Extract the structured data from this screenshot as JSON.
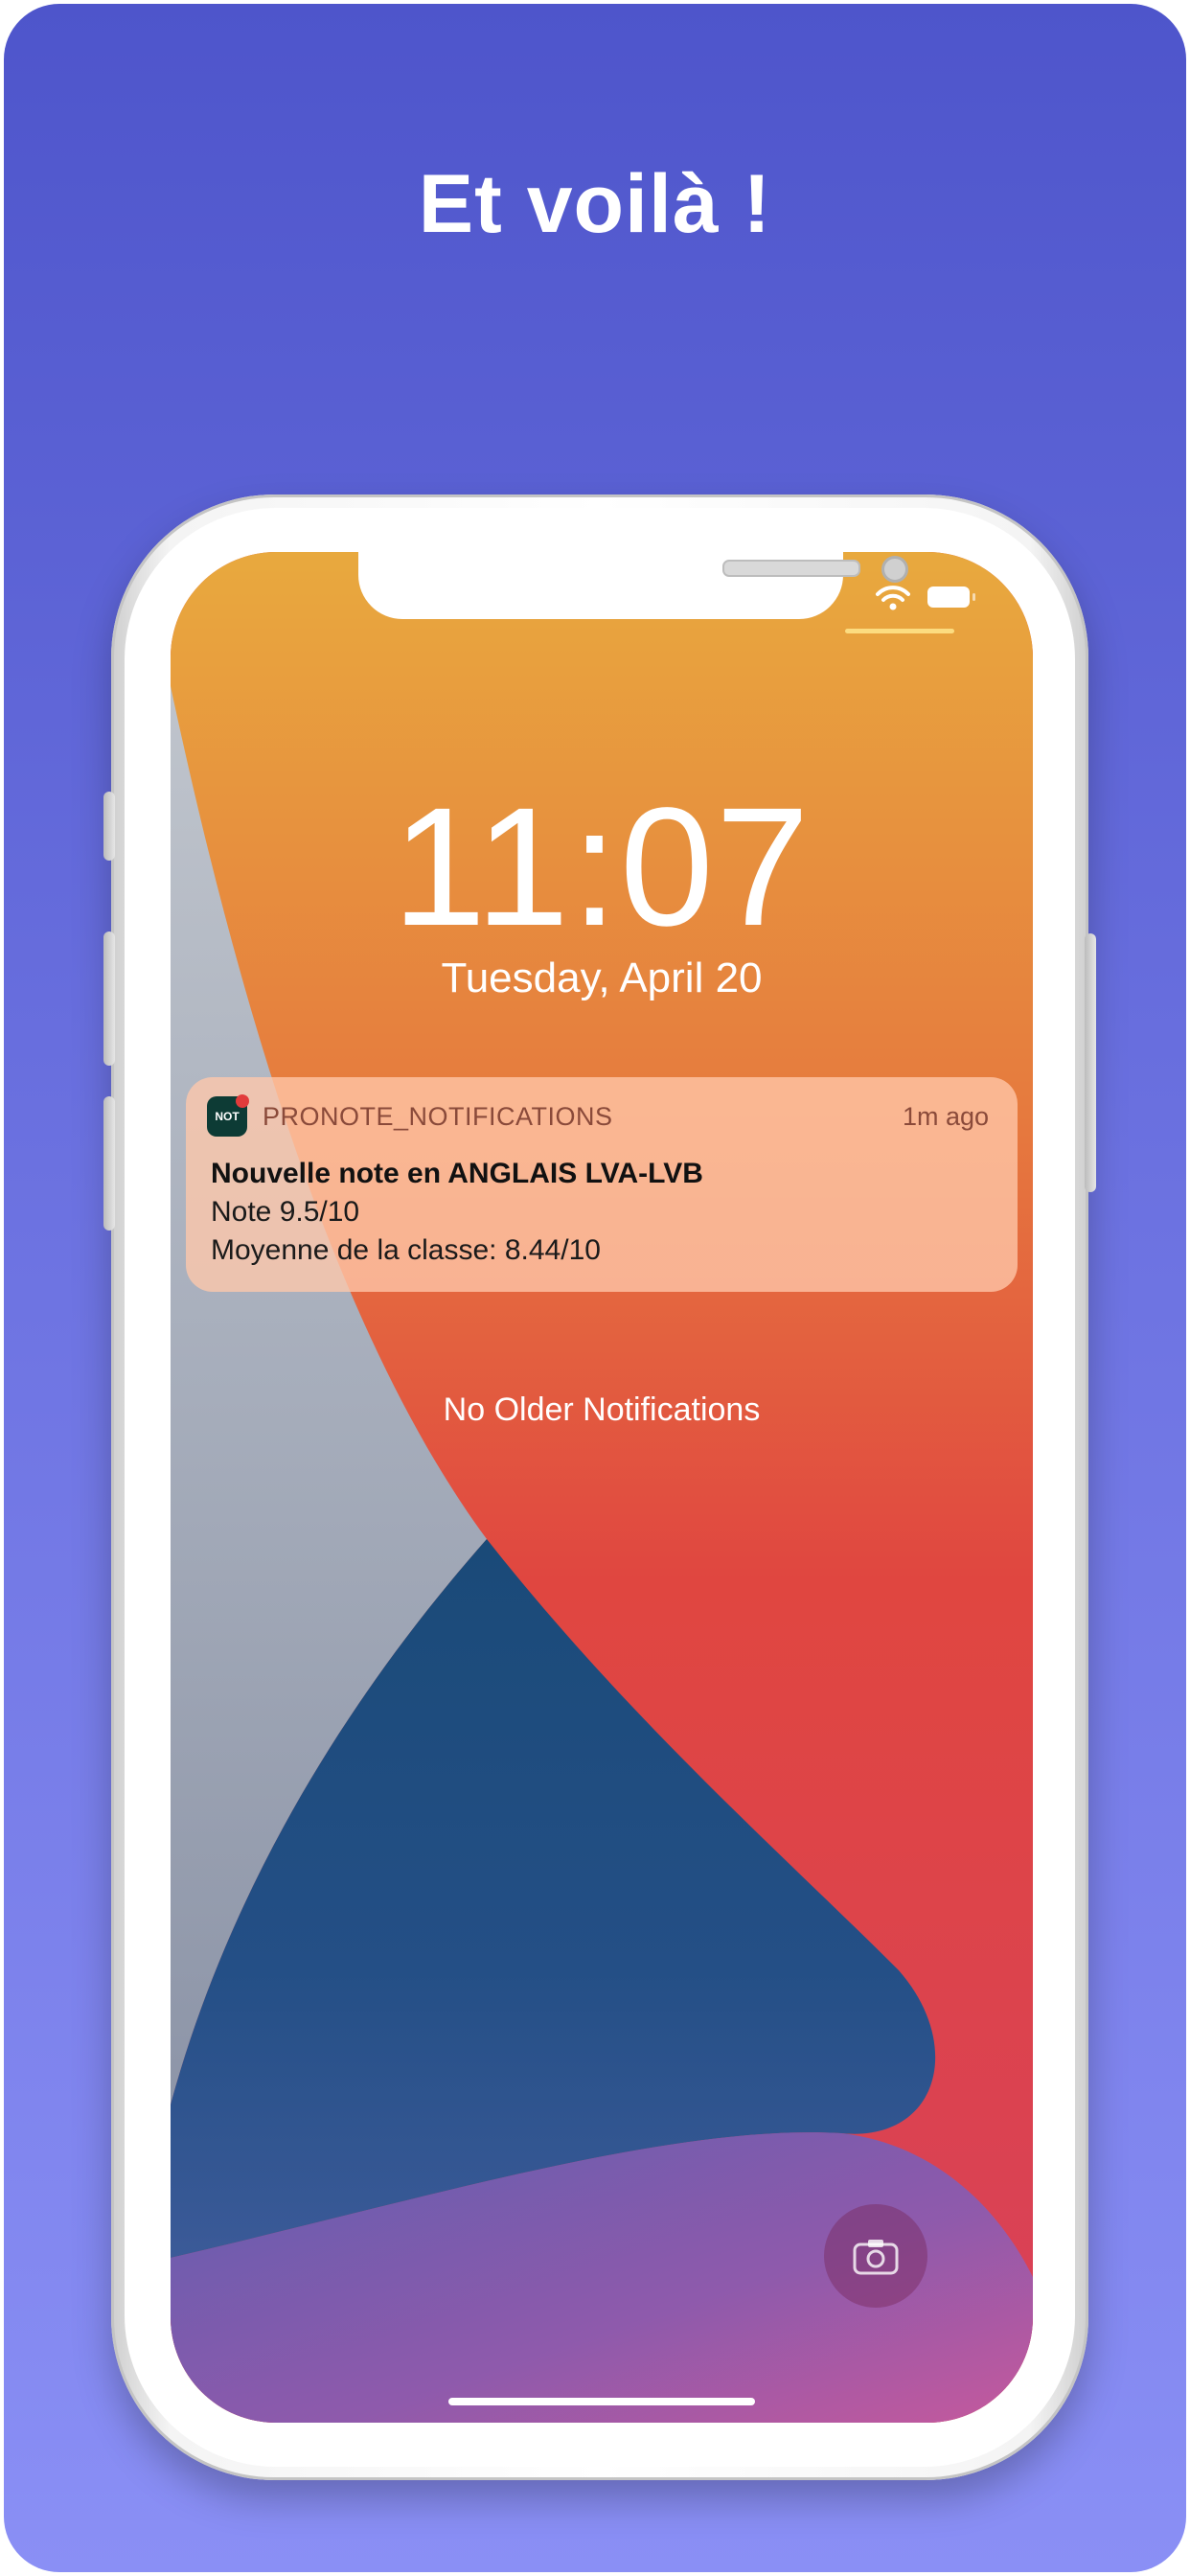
{
  "promo": {
    "headline": "Et voilà !"
  },
  "lockscreen": {
    "time": "11:07",
    "date": "Tuesday, April 20",
    "no_older_notifications": "No Older Notifications"
  },
  "notification": {
    "app_icon_text": "NOT",
    "app_name": "PRONOTE_NOTIFICATIONS",
    "time_ago": "1m ago",
    "title": "Nouvelle note en ANGLAIS LVA-LVB",
    "line_1": "Note 9.5/10",
    "line_2": "Moyenne de la classe: 8.44/10"
  },
  "icons": {
    "status": [
      "wifi-icon",
      "battery-icon"
    ],
    "quick_action": "camera-icon"
  },
  "colors": {
    "background_top": "#4e55cb",
    "background_bottom": "#8a8ff5",
    "wallpaper_orange": "#e8a33e",
    "wallpaper_red": "#e04640",
    "wallpaper_blue": "#1f4f7a"
  }
}
